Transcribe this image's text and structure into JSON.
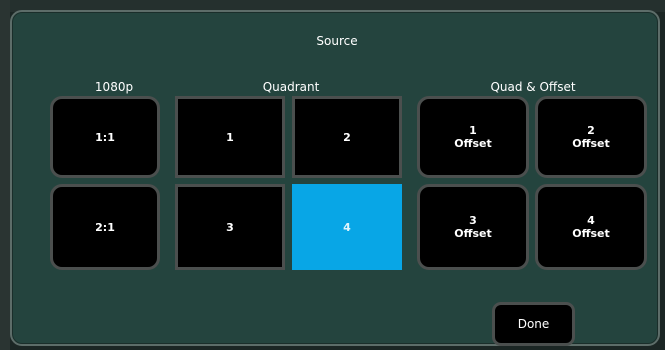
{
  "dialog": {
    "title": "Source",
    "groups": {
      "resolution_label": "1080p",
      "quadrant_label": "Quadrant",
      "quad_offset_label": "Quad & Offset"
    },
    "resolution_buttons": [
      {
        "label": "1:1"
      },
      {
        "label": "2:1"
      }
    ],
    "quadrant_buttons": [
      {
        "label": "1",
        "selected": false
      },
      {
        "label": "2",
        "selected": false
      },
      {
        "label": "3",
        "selected": false
      },
      {
        "label": "4",
        "selected": true
      }
    ],
    "quad_offset_buttons": [
      {
        "number": "1",
        "sub": "Offset"
      },
      {
        "number": "2",
        "sub": "Offset"
      },
      {
        "number": "3",
        "sub": "Offset"
      },
      {
        "number": "4",
        "sub": "Offset"
      }
    ],
    "done_label": "Done"
  },
  "colors": {
    "panel_bg": "#24443e",
    "button_bg": "#000000",
    "button_border": "#4b4f4e",
    "selected_bg": "#08a6e6",
    "text": "#ffffff"
  }
}
